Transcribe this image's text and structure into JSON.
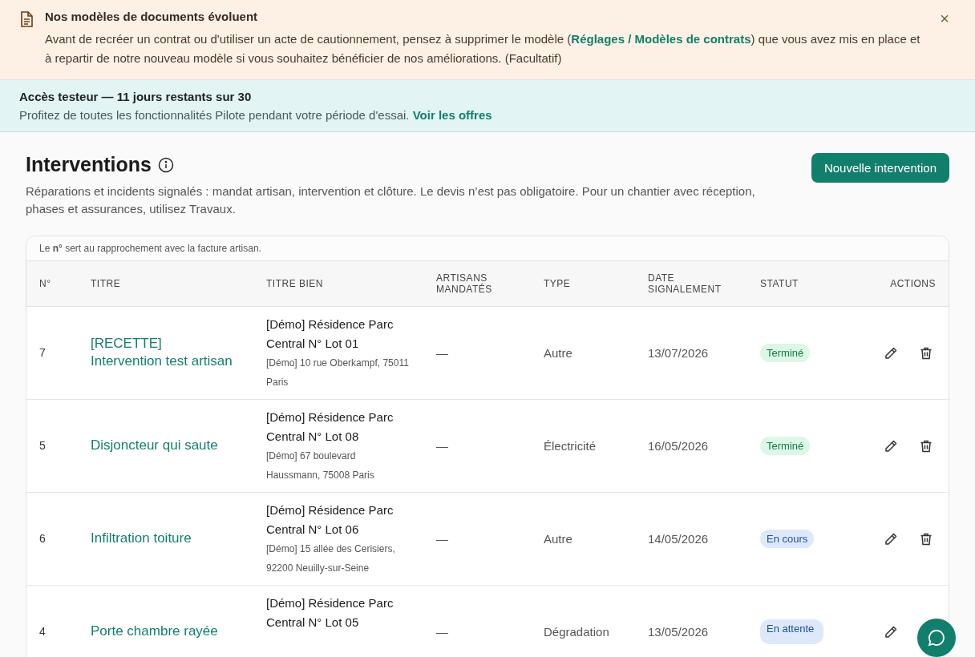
{
  "notice": {
    "title": "Nos modèles de documents évoluent",
    "text_before": "Avant de recréer un contrat ou d'utiliser un acte de cautionnement, pensez à supprimer le modèle (",
    "link": "Réglages / Modèles de contrats",
    "text_after": ") que vous avez mis en place et à repartir de notre nouveau modèle si vous souhaitez bénéficier de nos améliorations. (Facultatif)",
    "close": "×"
  },
  "trial": {
    "title": "Accès testeur — 11 jours restants sur 30",
    "text": "Profitez de toutes les fonctionnalités Pilote pendant votre période d'essai.",
    "link": "Voir les offres"
  },
  "page": {
    "title": "Interventions",
    "description": "Réparations et incidents signalés : mandat artisan, intervention et clôture. Le devis n’est pas obligatoire. Pour un chantier avec réception, phases et assurances, utilisez Travaux.",
    "new_button": "Nouvelle intervention"
  },
  "table": {
    "caption": "Le **n°** sert au rapprochement avec la facture artisan.",
    "columns": [
      "N°",
      "TITRE",
      "TITRE BIEN",
      "ARTISANS MANDATÉS",
      "TYPE",
      "DATE SIGNALEMENT",
      "STATUT",
      "ACTIONS"
    ],
    "rows": [
      {
        "number": "7",
        "title": "[RECETTE] Intervention test artisan",
        "property": "[Démo] Résidence Parc Central N° Lot 01",
        "address": "[Démo] 10 rue Oberkampf, 75011 Paris",
        "artisans": "—",
        "type": "Autre",
        "date": "13/07/2026",
        "status": {
          "label": "Terminé",
          "kind": "done"
        }
      },
      {
        "number": "5",
        "title": "Disjoncteur qui saute",
        "property": "[Démo] Résidence Parc Central N° Lot 08",
        "address": "[Démo] 67 boulevard Haussmann, 75008 Paris",
        "artisans": "—",
        "type": "Électricité",
        "date": "16/05/2026",
        "status": {
          "label": "Terminé",
          "kind": "done"
        }
      },
      {
        "number": "6",
        "title": "Infiltration toiture",
        "property": "[Démo] Résidence Parc Central N° Lot 06",
        "address": "[Démo] 15 allée des Cerisiers, 92200 Neuilly-sur-Seine",
        "artisans": "—",
        "type": "Autre",
        "date": "14/05/2026",
        "status": {
          "label": "En cours",
          "kind": "in_progress"
        }
      },
      {
        "number": "4",
        "title": "Porte chambre rayée",
        "property": "[Démo] Résidence Parc Central N° Lot 05",
        "artisans": "—",
        "type": "Dégradation",
        "date": "13/05/2026",
        "status": {
          "label": "En attente",
          "kind": "pending"
        }
      }
    ]
  }
}
